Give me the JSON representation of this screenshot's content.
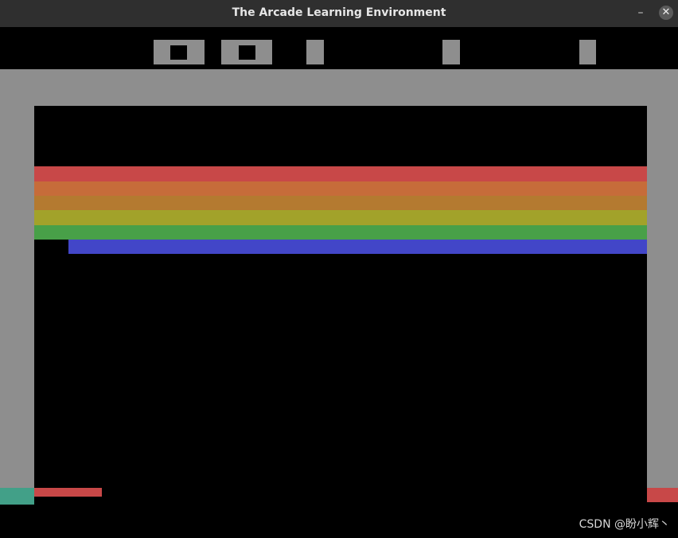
{
  "window": {
    "title": "The Arcade Learning Environment",
    "minimize_glyph": "–",
    "close_glyph": "✕"
  },
  "game": {
    "name": "Breakout",
    "score": "0",
    "lives": "5",
    "player": "1",
    "brick_rows": [
      {
        "color": "#c84848",
        "count_full": true
      },
      {
        "color": "#c66c3a",
        "count_full": true
      },
      {
        "color": "#b47a30",
        "count_full": true
      },
      {
        "color": "#a2a22a",
        "count_full": true
      },
      {
        "color": "#48a048",
        "count_full": true
      },
      {
        "color": "#4246c8",
        "count_full": false
      }
    ],
    "paddle_color": "#c84848",
    "wall_color": "#8e8e8e",
    "left_marker_color": "#42a088",
    "right_marker_color": "#c84848"
  },
  "watermark": "CSDN @盼小辉丶"
}
